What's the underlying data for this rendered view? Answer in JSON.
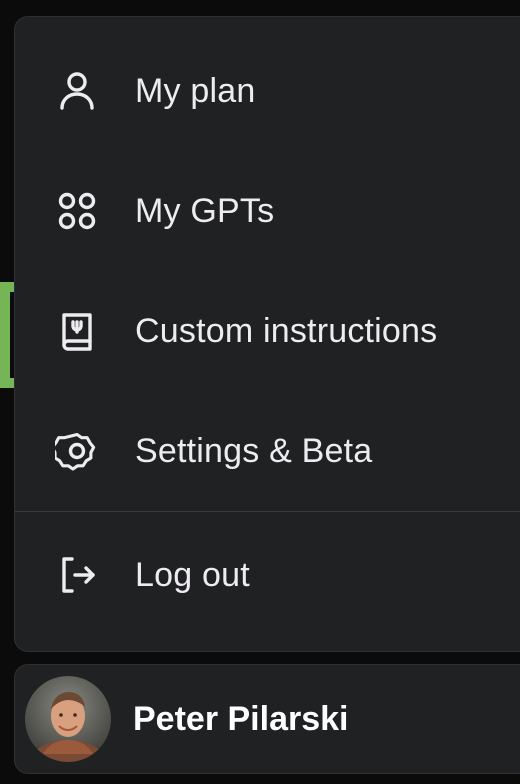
{
  "menu": {
    "items": [
      {
        "label": "My plan",
        "icon": "user-icon"
      },
      {
        "label": "My GPTs",
        "icon": "grid-circles-icon"
      },
      {
        "label": "Custom instructions",
        "icon": "instructions-book-icon"
      },
      {
        "label": "Settings & Beta",
        "icon": "gear-icon"
      },
      {
        "label": "Log out",
        "icon": "logout-icon"
      }
    ],
    "highlighted_item": "Custom instructions"
  },
  "profile": {
    "name": "Peter Pilarski",
    "avatar": "user-avatar-photo"
  },
  "colors": {
    "background": "#0b0b0b",
    "menu_bg": "#202123",
    "text": "#ececf1",
    "highlight": "#75b555"
  }
}
